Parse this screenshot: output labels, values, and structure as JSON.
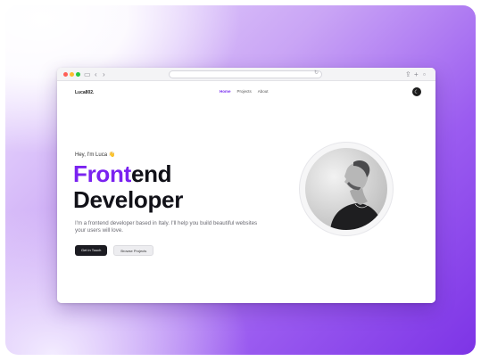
{
  "site": {
    "logo": "Luca802.",
    "nav": [
      {
        "label": "Home",
        "active": true
      },
      {
        "label": "Projects",
        "active": false
      },
      {
        "label": "About",
        "active": false
      }
    ],
    "theme_toggle_icon": "moon-icon",
    "greeting": "Hey, I'm Luca",
    "greeting_emoji": "👋",
    "title_accent": "Front",
    "title_rest": "end",
    "title_line2": "Developer",
    "description": "I'm a frontend developer based in Italy. I'll help you build beautiful websites your users will love.",
    "primary_button": "Get in Touch",
    "secondary_button": "Browse Projects"
  },
  "colors": {
    "accent": "#7a22f0",
    "background_gradient_end": "#7d34e6",
    "dark": "#1c1c22"
  }
}
